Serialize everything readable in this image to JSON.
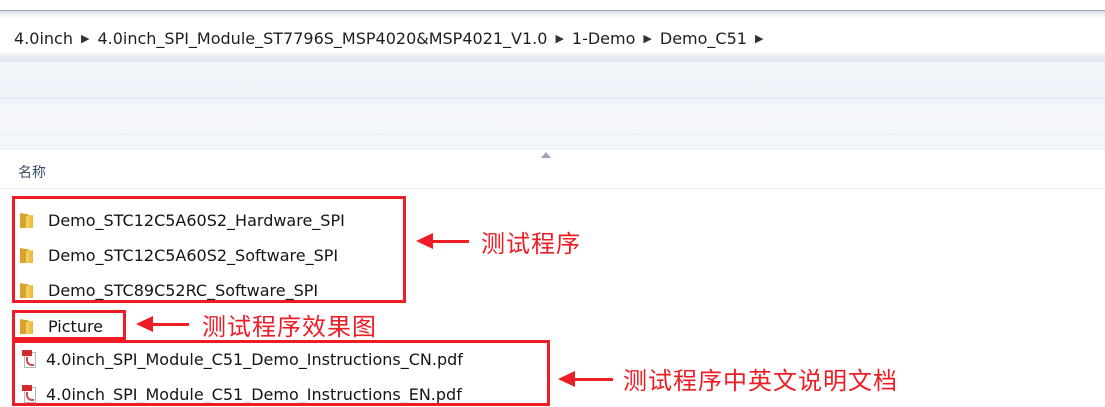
{
  "breadcrumb": {
    "items": [
      "4.0inch",
      "4.0inch_SPI_Module_ST7796S_MSP4020&MSP4021_V1.0",
      "1-Demo",
      "Demo_C51"
    ],
    "separator": "▶"
  },
  "list": {
    "column_name": "名称",
    "files": [
      {
        "name": "Demo_STC12C5A60S2_Hardware_SPI",
        "type": "folder"
      },
      {
        "name": "Demo_STC12C5A60S2_Software_SPI",
        "type": "folder"
      },
      {
        "name": "Demo_STC89C52RC_Software_SPI",
        "type": "folder"
      },
      {
        "name": "Picture",
        "type": "folder"
      },
      {
        "name": "4.0inch_SPI_Module_C51_Demo_Instructions_CN.pdf",
        "type": "pdf"
      },
      {
        "name": "4.0inch_SPI_Module_C51_Demo_Instructions_EN.pdf",
        "type": "pdf"
      }
    ]
  },
  "annotations": {
    "test_program": "测试程序",
    "test_effect_images": "测试程序效果图",
    "instructions_cn_en": "测试程序中英文说明文档"
  },
  "colors": {
    "annotation": "#ee1c24",
    "folder": "#eab736",
    "text": "#141414"
  }
}
